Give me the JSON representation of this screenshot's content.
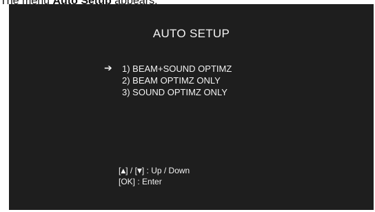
{
  "caption": {
    "prefix": "The menu ",
    "bold": "Auto Setup",
    "suffix": " appears."
  },
  "osd": {
    "title": "AUTO SETUP",
    "cursor_icon": "right-arrow-icon",
    "selected_index": 0,
    "items": [
      {
        "label": "1) BEAM+SOUND OPTIMZ"
      },
      {
        "label": "2) BEAM OPTIMZ ONLY"
      },
      {
        "label": "3) SOUND OPTIMZ ONLY"
      }
    ],
    "help": {
      "nav_up_key": "▲",
      "nav_down_key": "▼",
      "nav_text": ":  Up / Down",
      "ok_key": "[OK]",
      "ok_text": " : Enter"
    }
  },
  "colors": {
    "screen_bg": "#1e1e1e",
    "osd_text": "#f2f2f2",
    "page_bg": "#ffffff"
  }
}
